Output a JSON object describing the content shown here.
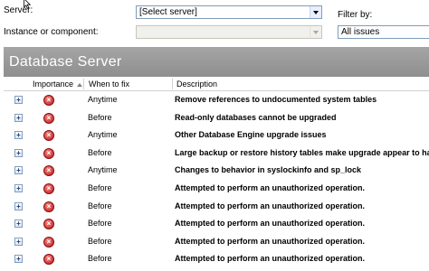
{
  "filters": {
    "server_label": "Server:",
    "server_value": "[Select server]",
    "instance_label": "Instance or component:",
    "instance_value": "",
    "filter_label": "Filter by:",
    "filter_value": "All issues"
  },
  "panel": {
    "title": "Database Server",
    "columns": {
      "importance": "Importance",
      "when": "When to fix",
      "description": "Description"
    }
  },
  "rows": [
    {
      "when": "Anytime",
      "description": "Remove references to undocumented system tables"
    },
    {
      "when": "Before",
      "description": "Read-only databases cannot be upgraded"
    },
    {
      "when": "Anytime",
      "description": "Other Database Engine upgrade issues"
    },
    {
      "when": "Before",
      "description": "Large backup or restore history tables make upgrade appear to hang"
    },
    {
      "when": "Anytime",
      "description": "Changes to behavior in syslockinfo and sp_lock"
    },
    {
      "when": "Before",
      "description": "Attempted to perform an unauthorized operation."
    },
    {
      "when": "Before",
      "description": "Attempted to perform an unauthorized operation."
    },
    {
      "when": "Before",
      "description": "Attempted to perform an unauthorized operation."
    },
    {
      "when": "Before",
      "description": "Attempted to perform an unauthorized operation."
    },
    {
      "when": "Before",
      "description": "Attempted to perform an unauthorized operation."
    }
  ],
  "icons": {
    "importance": "error-icon",
    "expander": "expand-icon",
    "error_color": "#c31414"
  }
}
